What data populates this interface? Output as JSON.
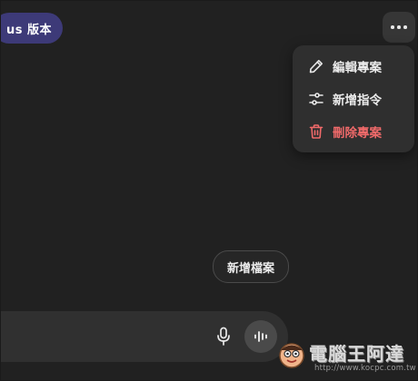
{
  "plan_badge": {
    "label": "us 版本"
  },
  "more_button": {
    "icon": "more-horizontal-icon"
  },
  "project_menu": {
    "items": [
      {
        "label": "編輯專案",
        "icon": "pencil-icon"
      },
      {
        "label": "新增指令",
        "icon": "sliders-icon"
      },
      {
        "label": "刪除專案",
        "icon": "trash-icon",
        "color": "#f06a6a"
      }
    ]
  },
  "add_file_button": {
    "label": "新增檔案"
  },
  "composer": {
    "mic_icon": "microphone-icon",
    "voice_icon": "voice-waveform-icon"
  },
  "watermark": {
    "text": "電腦王阿達",
    "url": "http://www.kocpc.com.tw"
  },
  "colors": {
    "background": "#212121",
    "badge": "#3d3a78",
    "menu": "#2f2f2f",
    "danger": "#f06a6a"
  }
}
